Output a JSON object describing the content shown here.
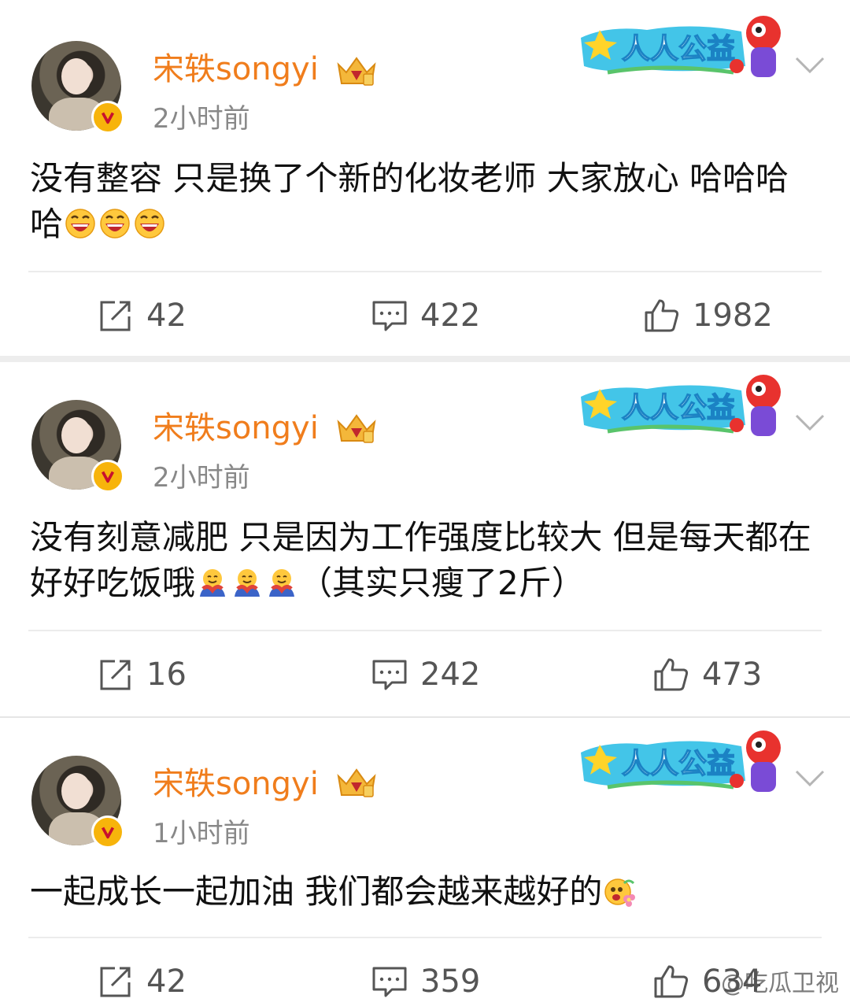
{
  "accent_color": "#f07d1c",
  "posts": [
    {
      "username": "宋轶songyi",
      "time": "2小时前",
      "banner_text": "人人公益",
      "content_text": "没有整容 只是换了个新的化妆老师 大家放心 哈哈哈哈",
      "content_emojis": [
        "laugh-emoji",
        "laugh-emoji",
        "laugh-emoji"
      ],
      "reposts": "42",
      "comments": "422",
      "likes": "1982"
    },
    {
      "username": "宋轶songyi",
      "time": "2小时前",
      "banner_text": "人人公益",
      "content_text": "没有刻意减肥 只是因为工作强度比较大 但是每天都在好好吃饭哦",
      "content_emojis": [
        "hug-emoji",
        "hug-emoji",
        "hug-emoji"
      ],
      "content_suffix": "（其实只瘦了2斤）",
      "reposts": "16",
      "comments": "242",
      "likes": "473"
    },
    {
      "username": "宋轶songyi",
      "time": "1小时前",
      "banner_text": "人人公益",
      "content_text": "一起成长一起加油 我们都会越来越好的",
      "content_emojis": [
        "flower-face-emoji"
      ],
      "reposts": "42",
      "comments": "359",
      "likes": "634"
    }
  ],
  "watermark": "@吃瓜卫视",
  "icons": [
    "repost-icon",
    "comment-icon",
    "like-icon",
    "chevron-down-icon",
    "verified-badge-icon",
    "crown-badge-icon"
  ]
}
